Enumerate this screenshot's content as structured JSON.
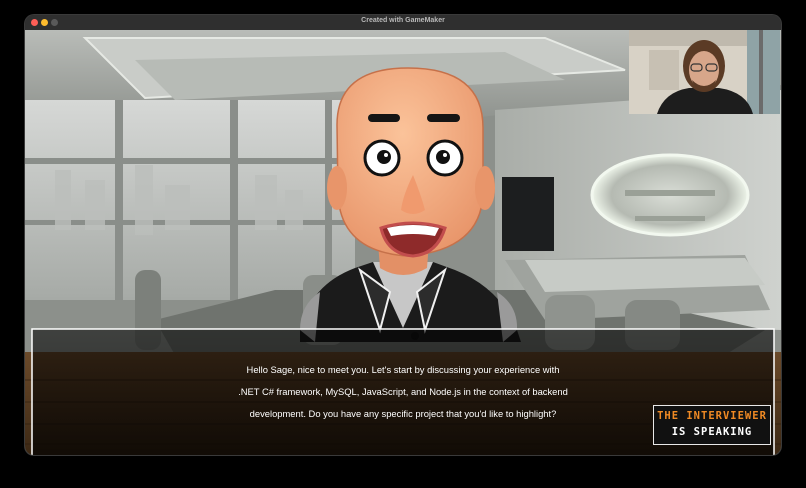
{
  "window": {
    "title": "Created with GameMaker",
    "traffic_lights": {
      "close": "#ff5f57",
      "minimize": "#febc2e",
      "zoom": "#5a5a5a"
    }
  },
  "dialogue": {
    "lines": [
      "Hello Sage, nice to meet you. Let's start by discussing your experience with",
      ".NET C# framework, MySQL, JavaScript, and Node.js in the context of backend",
      "development. Do you have any specific project that you'd like to highlight?"
    ]
  },
  "speaker_badge": {
    "line1": "THE INTERVIEWER",
    "line2": "IS SPEAKING",
    "colors": {
      "line1": "#f08a24",
      "line2": "#ffffff",
      "border": "#e8e8e8"
    }
  },
  "colors": {
    "dialog_border": "#ffffff",
    "floor_wood": "#4a3520",
    "skin": "#f3a97e"
  }
}
